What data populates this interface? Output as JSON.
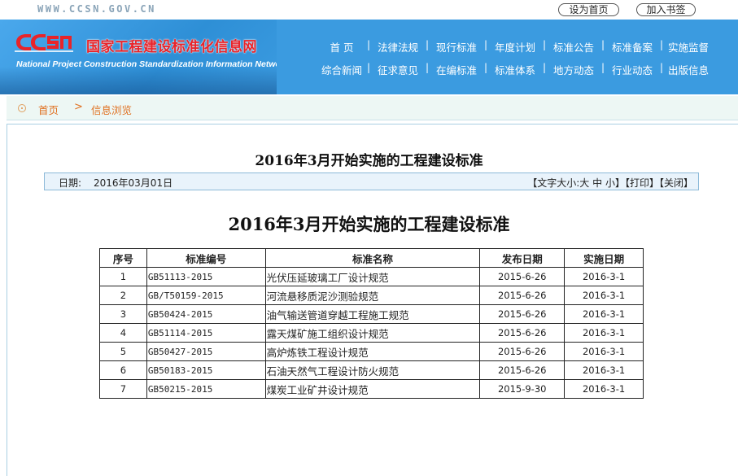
{
  "site": {
    "url_text": "WWW.CCSN.GOV.CN",
    "set_home_label": "设为首页",
    "bookmark_label": "加入书签",
    "logo_mark": "CCSN",
    "logo_cn": "国家工程建设标准化信息网",
    "logo_en": "National Project Construction Standardization Information Network"
  },
  "nav": {
    "row1": [
      "首 页",
      "法律法规",
      "现行标准",
      "年度计划",
      "标准公告",
      "标准备案",
      "实施监督"
    ],
    "row2": [
      "综合新闻",
      "征求意见",
      "在编标准",
      "标准体系",
      "地方动态",
      "行业动态",
      "出版信息"
    ],
    "separator": "|"
  },
  "breadcrumb": {
    "home": "首页",
    "arrow": ">",
    "current": "信息浏览"
  },
  "article": {
    "title": "2016年3月开始实施的工程建设标准",
    "date_label": "日期:",
    "date": "2016年03月01日",
    "font_size_label": "【文字大小:",
    "font_large": "大",
    "font_medium": "中",
    "font_small": "小】",
    "print_label": "【打印】",
    "close_label": "【关闭】",
    "table_title": "2016年3月开始实施的工程建设标准"
  },
  "table": {
    "headers": [
      "序号",
      "标准编号",
      "标准名称",
      "发布日期",
      "实施日期"
    ],
    "rows": [
      [
        "1",
        "GB51113-2015",
        "光伏压延玻璃工厂设计规范",
        "2015-6-26",
        "2016-3-1"
      ],
      [
        "2",
        "GB/T50159-2015",
        "河流悬移质泥沙测验规范",
        "2015-6-26",
        "2016-3-1"
      ],
      [
        "3",
        "GB50424-2015",
        "油气输送管道穿越工程施工规范",
        "2015-6-26",
        "2016-3-1"
      ],
      [
        "4",
        "GB51114-2015",
        "露天煤矿施工组织设计规范",
        "2015-6-26",
        "2016-3-1"
      ],
      [
        "5",
        "GB50427-2015",
        "高炉炼铁工程设计规范",
        "2015-6-26",
        "2016-3-1"
      ],
      [
        "6",
        "GB50183-2015",
        "石油天然气工程设计防火规范",
        "2015-6-26",
        "2016-3-1"
      ],
      [
        "7",
        "GB50215-2015",
        "煤炭工业矿井设计规范",
        "2015-9-30",
        "2016-3-1"
      ]
    ]
  },
  "colors": {
    "header_blue": "#3b9be0",
    "logo_red": "#e8242a",
    "crumb_orange": "#e07020"
  }
}
